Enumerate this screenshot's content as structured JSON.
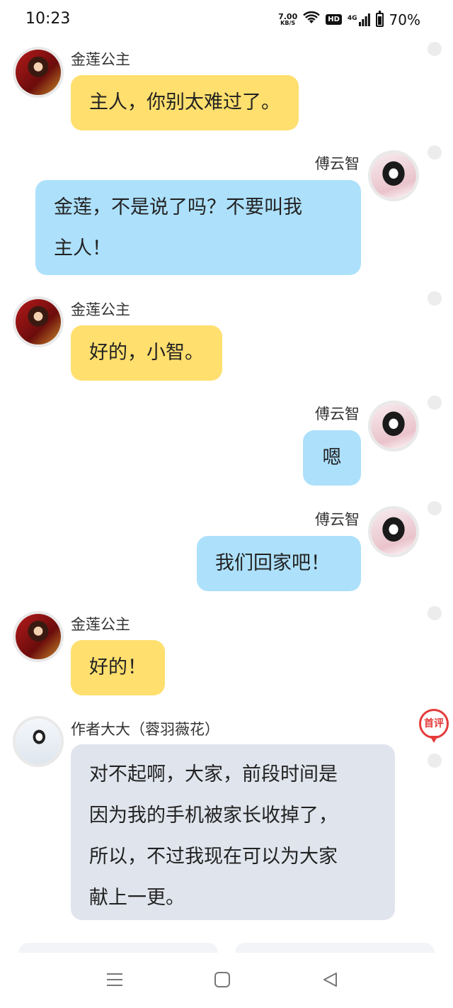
{
  "status_bar": {
    "time": "10:23",
    "speed_value": "7.00",
    "speed_unit": "KB/S",
    "hd": "HD",
    "network": "4G",
    "battery": "70%"
  },
  "messages": [
    {
      "sender": "金莲公主",
      "text": "主人，你别太难过了。",
      "side": "left",
      "avatar_icon": "jinlian-avatar-icon"
    },
    {
      "sender": "傅云智",
      "lines": [
        "金莲，不是说了吗？不要叫我",
        "主人！"
      ],
      "side": "right",
      "avatar_icon": "fuyunzhi-avatar-icon"
    },
    {
      "sender": "金莲公主",
      "text": "好的，小智。",
      "side": "left",
      "avatar_icon": "jinlian-avatar-icon"
    },
    {
      "sender": "傅云智",
      "text": "嗯",
      "side": "right",
      "avatar_icon": "fuyunzhi-avatar-icon"
    },
    {
      "sender": "傅云智",
      "text": "我们回家吧！",
      "side": "right",
      "avatar_icon": "fuyunzhi-avatar-icon"
    },
    {
      "sender": "金莲公主",
      "text": "好的！",
      "side": "left",
      "avatar_icon": "jinlian-avatar-icon"
    },
    {
      "sender": "作者大大（蓉羽薇花）",
      "lines": [
        "对不起啊，大家，前段时间是",
        "因为我的手机被家长收掉了，",
        "所以，不过我现在可以为大家",
        "献上一更。"
      ],
      "side": "left",
      "avatar_icon": "author-avatar-icon"
    }
  ],
  "first_comment_badge": "首评",
  "colors": {
    "left_bubble": "#ffdf6e",
    "right_bubble": "#ade0fb",
    "author_bubble": "#e0e4ec",
    "badge": "#e53b3b"
  },
  "nav": {
    "menu_icon": "menu-icon",
    "home_icon": "home-square-icon",
    "back_icon": "back-triangle-icon"
  }
}
